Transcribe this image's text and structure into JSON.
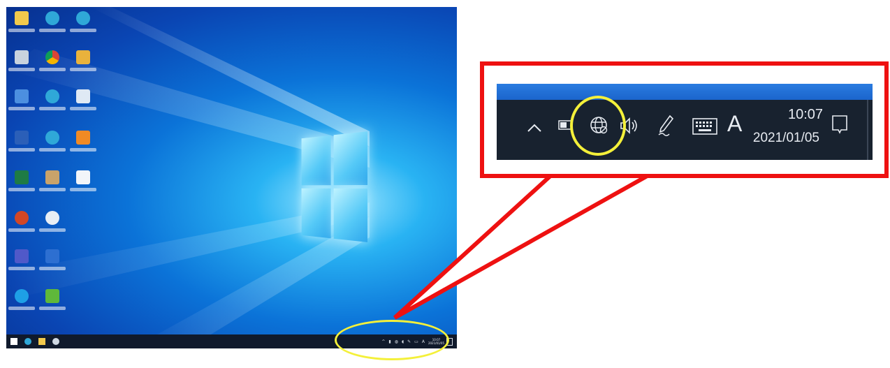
{
  "tray": {
    "time": "10:07",
    "date": "2021/01/05",
    "ime_indicator": "A",
    "icons": [
      "chevron-up-icon",
      "battery-icon",
      "globe-network-icon",
      "volume-icon",
      "pen-icon",
      "touch-keyboard-icon",
      "action-center-icon"
    ]
  },
  "colors": {
    "callout_red": "#ee1111",
    "highlight_yellow": "#f4f03a",
    "taskbar_dark": "#18222f"
  }
}
